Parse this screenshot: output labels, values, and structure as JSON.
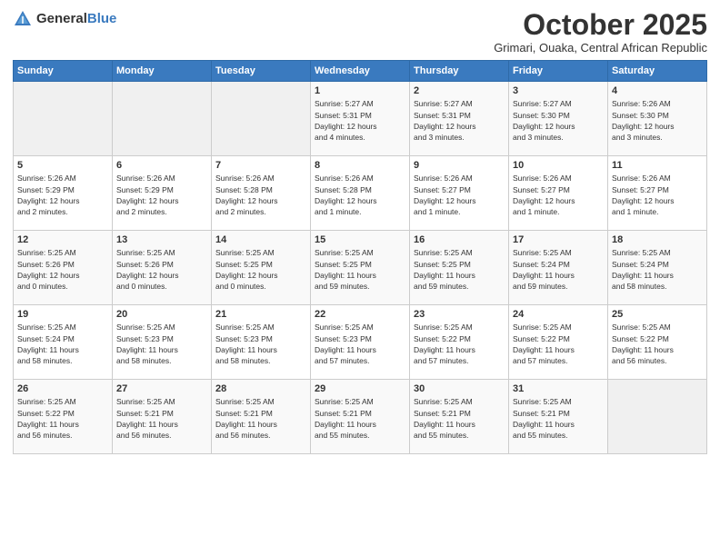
{
  "header": {
    "logo_general": "General",
    "logo_blue": "Blue",
    "month_title": "October 2025",
    "subtitle": "Grimari, Ouaka, Central African Republic"
  },
  "weekdays": [
    "Sunday",
    "Monday",
    "Tuesday",
    "Wednesday",
    "Thursday",
    "Friday",
    "Saturday"
  ],
  "weeks": [
    [
      {
        "day": "",
        "info": ""
      },
      {
        "day": "",
        "info": ""
      },
      {
        "day": "",
        "info": ""
      },
      {
        "day": "1",
        "info": "Sunrise: 5:27 AM\nSunset: 5:31 PM\nDaylight: 12 hours\nand 4 minutes."
      },
      {
        "day": "2",
        "info": "Sunrise: 5:27 AM\nSunset: 5:31 PM\nDaylight: 12 hours\nand 3 minutes."
      },
      {
        "day": "3",
        "info": "Sunrise: 5:27 AM\nSunset: 5:30 PM\nDaylight: 12 hours\nand 3 minutes."
      },
      {
        "day": "4",
        "info": "Sunrise: 5:26 AM\nSunset: 5:30 PM\nDaylight: 12 hours\nand 3 minutes."
      }
    ],
    [
      {
        "day": "5",
        "info": "Sunrise: 5:26 AM\nSunset: 5:29 PM\nDaylight: 12 hours\nand 2 minutes."
      },
      {
        "day": "6",
        "info": "Sunrise: 5:26 AM\nSunset: 5:29 PM\nDaylight: 12 hours\nand 2 minutes."
      },
      {
        "day": "7",
        "info": "Sunrise: 5:26 AM\nSunset: 5:28 PM\nDaylight: 12 hours\nand 2 minutes."
      },
      {
        "day": "8",
        "info": "Sunrise: 5:26 AM\nSunset: 5:28 PM\nDaylight: 12 hours\nand 1 minute."
      },
      {
        "day": "9",
        "info": "Sunrise: 5:26 AM\nSunset: 5:27 PM\nDaylight: 12 hours\nand 1 minute."
      },
      {
        "day": "10",
        "info": "Sunrise: 5:26 AM\nSunset: 5:27 PM\nDaylight: 12 hours\nand 1 minute."
      },
      {
        "day": "11",
        "info": "Sunrise: 5:26 AM\nSunset: 5:27 PM\nDaylight: 12 hours\nand 1 minute."
      }
    ],
    [
      {
        "day": "12",
        "info": "Sunrise: 5:25 AM\nSunset: 5:26 PM\nDaylight: 12 hours\nand 0 minutes."
      },
      {
        "day": "13",
        "info": "Sunrise: 5:25 AM\nSunset: 5:26 PM\nDaylight: 12 hours\nand 0 minutes."
      },
      {
        "day": "14",
        "info": "Sunrise: 5:25 AM\nSunset: 5:25 PM\nDaylight: 12 hours\nand 0 minutes."
      },
      {
        "day": "15",
        "info": "Sunrise: 5:25 AM\nSunset: 5:25 PM\nDaylight: 11 hours\nand 59 minutes."
      },
      {
        "day": "16",
        "info": "Sunrise: 5:25 AM\nSunset: 5:25 PM\nDaylight: 11 hours\nand 59 minutes."
      },
      {
        "day": "17",
        "info": "Sunrise: 5:25 AM\nSunset: 5:24 PM\nDaylight: 11 hours\nand 59 minutes."
      },
      {
        "day": "18",
        "info": "Sunrise: 5:25 AM\nSunset: 5:24 PM\nDaylight: 11 hours\nand 58 minutes."
      }
    ],
    [
      {
        "day": "19",
        "info": "Sunrise: 5:25 AM\nSunset: 5:24 PM\nDaylight: 11 hours\nand 58 minutes."
      },
      {
        "day": "20",
        "info": "Sunrise: 5:25 AM\nSunset: 5:23 PM\nDaylight: 11 hours\nand 58 minutes."
      },
      {
        "day": "21",
        "info": "Sunrise: 5:25 AM\nSunset: 5:23 PM\nDaylight: 11 hours\nand 58 minutes."
      },
      {
        "day": "22",
        "info": "Sunrise: 5:25 AM\nSunset: 5:23 PM\nDaylight: 11 hours\nand 57 minutes."
      },
      {
        "day": "23",
        "info": "Sunrise: 5:25 AM\nSunset: 5:22 PM\nDaylight: 11 hours\nand 57 minutes."
      },
      {
        "day": "24",
        "info": "Sunrise: 5:25 AM\nSunset: 5:22 PM\nDaylight: 11 hours\nand 57 minutes."
      },
      {
        "day": "25",
        "info": "Sunrise: 5:25 AM\nSunset: 5:22 PM\nDaylight: 11 hours\nand 56 minutes."
      }
    ],
    [
      {
        "day": "26",
        "info": "Sunrise: 5:25 AM\nSunset: 5:22 PM\nDaylight: 11 hours\nand 56 minutes."
      },
      {
        "day": "27",
        "info": "Sunrise: 5:25 AM\nSunset: 5:21 PM\nDaylight: 11 hours\nand 56 minutes."
      },
      {
        "day": "28",
        "info": "Sunrise: 5:25 AM\nSunset: 5:21 PM\nDaylight: 11 hours\nand 56 minutes."
      },
      {
        "day": "29",
        "info": "Sunrise: 5:25 AM\nSunset: 5:21 PM\nDaylight: 11 hours\nand 55 minutes."
      },
      {
        "day": "30",
        "info": "Sunrise: 5:25 AM\nSunset: 5:21 PM\nDaylight: 11 hours\nand 55 minutes."
      },
      {
        "day": "31",
        "info": "Sunrise: 5:25 AM\nSunset: 5:21 PM\nDaylight: 11 hours\nand 55 minutes."
      },
      {
        "day": "",
        "info": ""
      }
    ]
  ]
}
